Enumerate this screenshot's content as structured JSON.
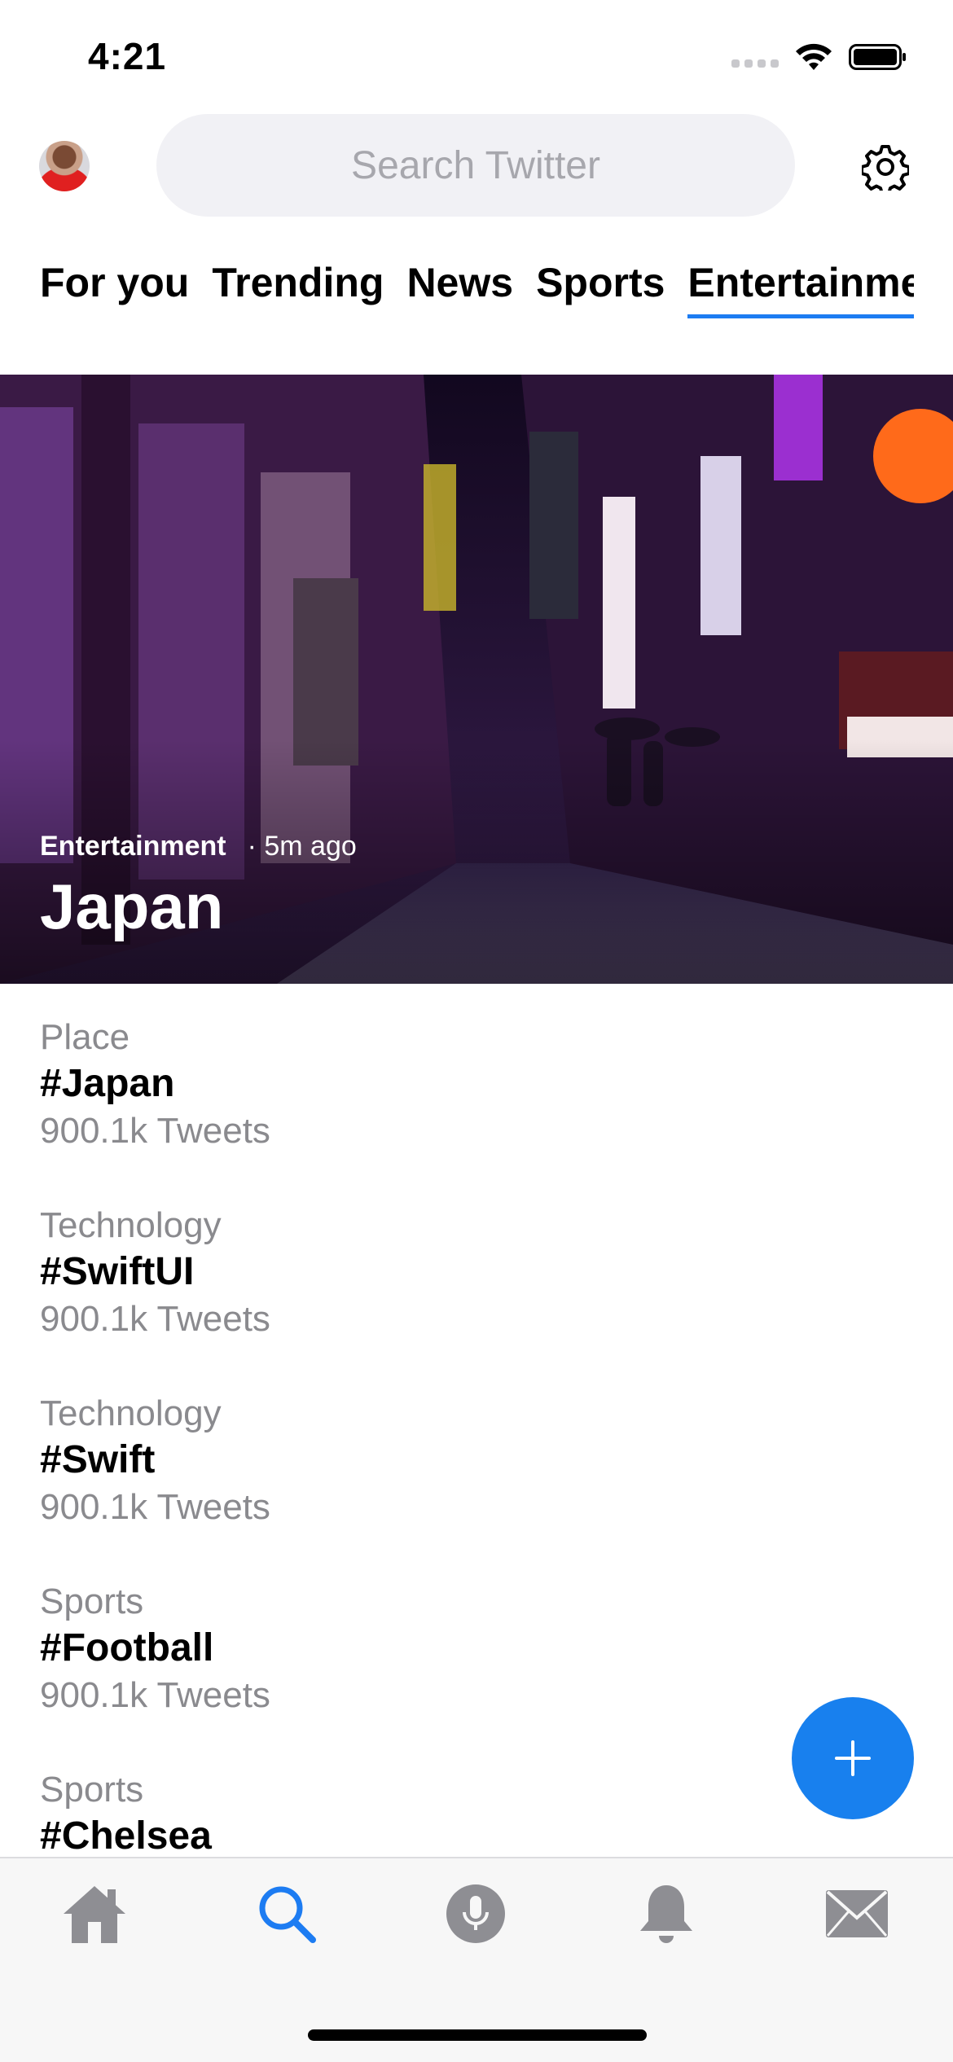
{
  "status_bar": {
    "time": "4:21"
  },
  "search": {
    "placeholder": "Search Twitter",
    "value": ""
  },
  "tabs": [
    {
      "label": "For you",
      "active": false
    },
    {
      "label": "Trending",
      "active": false
    },
    {
      "label": "News",
      "active": false
    },
    {
      "label": "Sports",
      "active": false
    },
    {
      "label": "Entertainment",
      "active": true
    }
  ],
  "hero": {
    "category": "Entertainment",
    "time": "· 5m ago",
    "title": "Japan"
  },
  "trends": [
    {
      "category": "Place",
      "tag": "#Japan",
      "count": "900.1k Tweets"
    },
    {
      "category": "Technology",
      "tag": "#SwiftUI",
      "count": "900.1k Tweets"
    },
    {
      "category": "Technology",
      "tag": "#Swift",
      "count": "900.1k Tweets"
    },
    {
      "category": "Sports",
      "tag": "#Football",
      "count": "900.1k Tweets"
    },
    {
      "category": "Sports",
      "tag": "#Chelsea",
      "count": ""
    }
  ],
  "tabbar": {
    "items": [
      "home-icon",
      "search-icon",
      "spaces-mic-icon",
      "bell-icon",
      "mail-icon"
    ],
    "active": "search-icon"
  },
  "colors": {
    "accent": "#1d7cf2",
    "fab": "#1880ee",
    "secondary_text": "#8a8a8e",
    "search_bg": "#f1f1f5"
  }
}
